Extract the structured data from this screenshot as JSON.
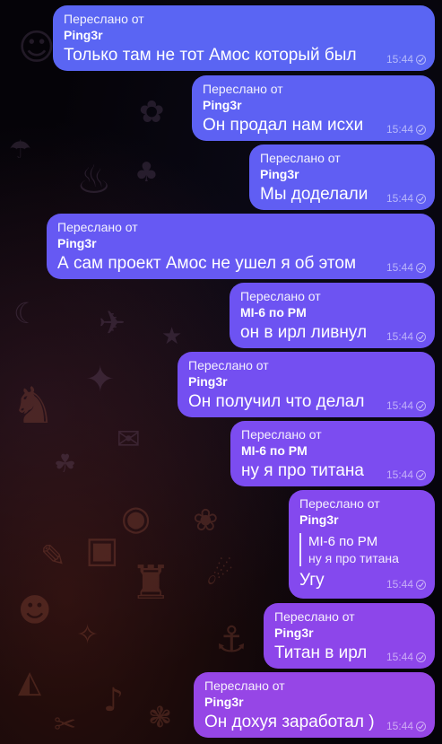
{
  "chat": {
    "messages": [
      {
        "forward_label": "Переслано от",
        "forward_from": "Ping3r",
        "text": "Только там не тот Амос который был",
        "time": "15:44"
      },
      {
        "forward_label": "Переслано от",
        "forward_from": "Ping3r",
        "text": "Он продал нам исхи",
        "time": "15:44"
      },
      {
        "forward_label": "Переслано от",
        "forward_from": "Ping3r",
        "text": "Мы доделали",
        "time": "15:44"
      },
      {
        "forward_label": "Переслано от",
        "forward_from": "Ping3r",
        "text": "А сам проект Амос не ушел я об этом",
        "time": "15:44"
      },
      {
        "forward_label": "Переслано от",
        "forward_from": "MI-6 по PM",
        "text": "он в ирл ливнул",
        "time": "15:44"
      },
      {
        "forward_label": "Переслано от",
        "forward_from": "Ping3r",
        "text": "Он получил что делал",
        "time": "15:44"
      },
      {
        "forward_label": "Переслано от",
        "forward_from": "MI-6 по PM",
        "text": "ну я про титана",
        "time": "15:44"
      },
      {
        "forward_label": "Переслано от",
        "forward_from": "Ping3r",
        "reply_author": "MI-6 по PM",
        "reply_text": "ну я про титана",
        "text": "Угу",
        "time": "15:44"
      },
      {
        "forward_label": "Переслано от",
        "forward_from": "Ping3r",
        "text": "Титан в ирл",
        "time": "15:44"
      },
      {
        "forward_label": "Переслано от",
        "forward_from": "Ping3r",
        "text": "Он дохуя заработал )",
        "time": "15:44"
      }
    ]
  },
  "colors": {
    "bubble_top": "#5b62f2",
    "bubble_mid": "#7a48f0",
    "bubble_bottom": "#9b4ae0",
    "background": "#050308"
  },
  "icons": {
    "read_status": "check-circle-icon"
  }
}
